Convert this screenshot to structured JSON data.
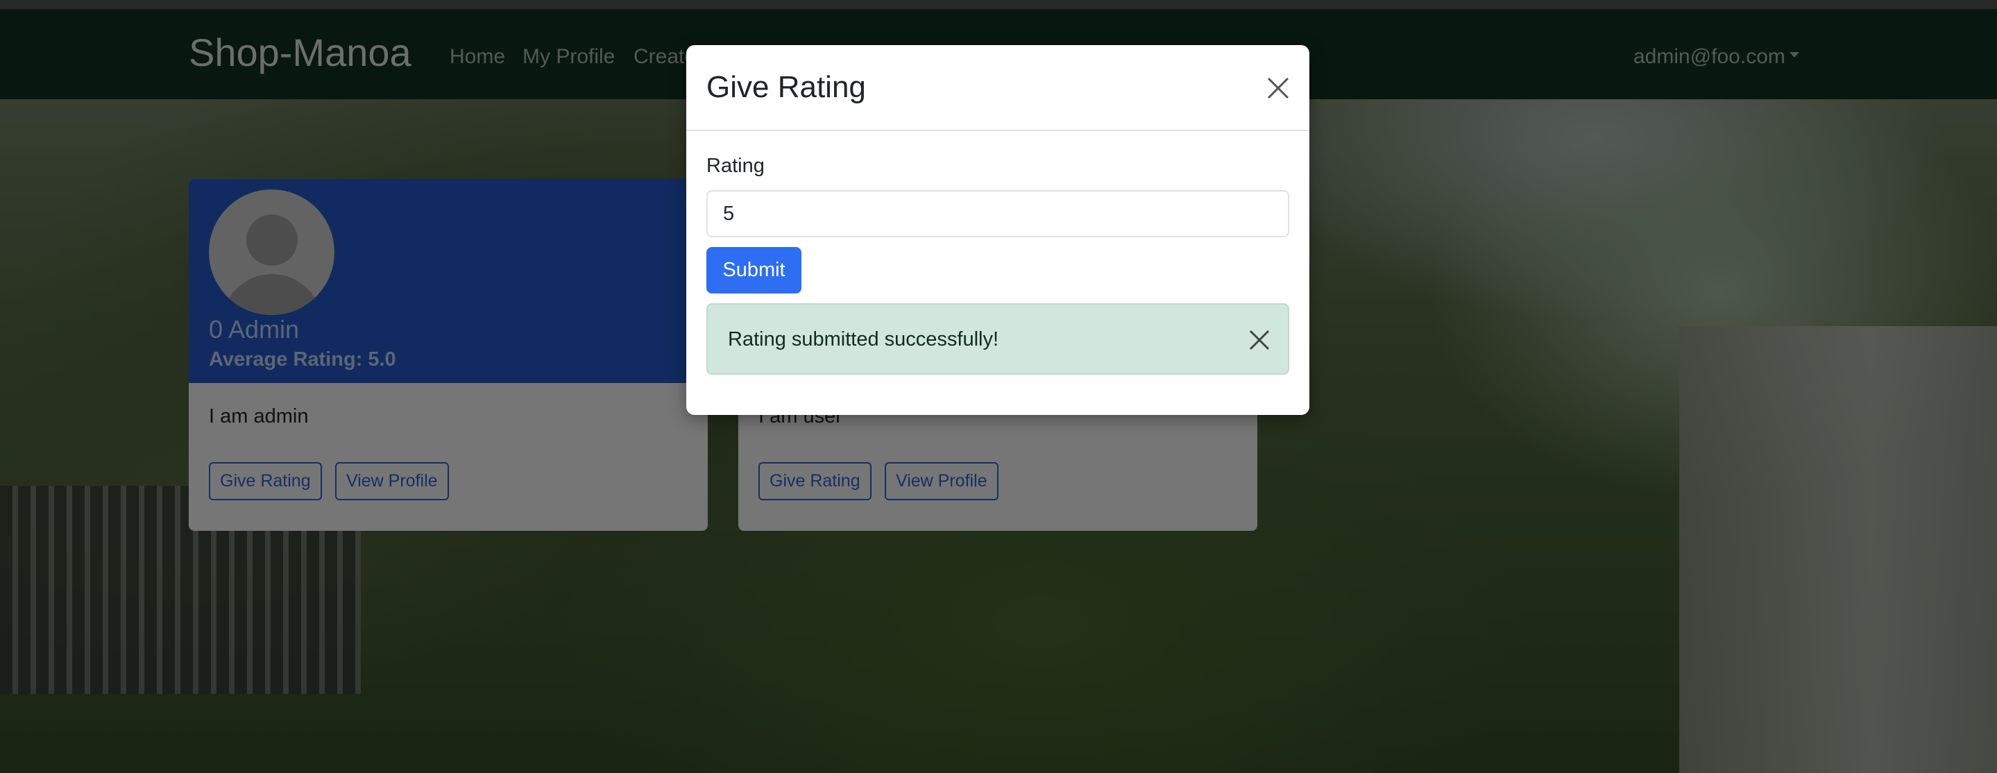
{
  "navbar": {
    "brand": "Shop-Manoa",
    "links": [
      "Home",
      "My Profile",
      "Create"
    ],
    "user_menu": "admin@foo.com"
  },
  "cards": [
    {
      "name": "0 Admin",
      "average_rating": "Average Rating: 5.0",
      "bio": "I am admin",
      "give_rating_label": "Give Rating",
      "view_profile_label": "View Profile"
    },
    {
      "bio": "I am user",
      "give_rating_label": "Give Rating",
      "view_profile_label": "View Profile"
    }
  ],
  "modal": {
    "title": "Give Rating",
    "field_label": "Rating",
    "rating_value": "5",
    "submit_label": "Submit",
    "alert_text": "Rating submitted successfully!"
  },
  "colors": {
    "navbar_bg": "#0f2d1f",
    "card_header": "#204fb0",
    "primary": "#2d6ef2",
    "alert_success_bg": "#d1e7dd"
  },
  "icons": {
    "modal_close": "close-icon",
    "alert_close": "close-icon",
    "user_menu_caret": "caret-down-icon",
    "avatar": "user-silhouette-icon"
  }
}
